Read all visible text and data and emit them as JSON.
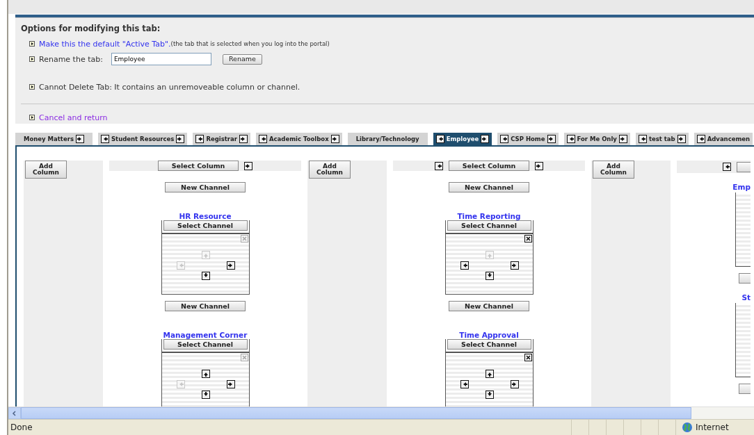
{
  "options": {
    "heading": "Options for modifying this tab:",
    "default_link": "Make this the default \"Active Tab\".",
    "default_note": "(the tab that is selected when you log into the portal)",
    "rename_label": "Rename the tab:",
    "rename_value": "Employee",
    "rename_button": "Rename",
    "delete_note": "Cannot Delete Tab: It contains an unremoveable column or channel.",
    "cancel_link": "Cancel and return"
  },
  "tabs": [
    {
      "label": "Money Matters",
      "selected": false,
      "move_left": false,
      "move_right": true
    },
    {
      "label": "Student Resources",
      "selected": false,
      "move_left": true,
      "move_right": true
    },
    {
      "label": "Registrar",
      "selected": false,
      "move_left": true,
      "move_right": true
    },
    {
      "label": "Academic Toolbox",
      "selected": false,
      "move_left": true,
      "move_right": true
    },
    {
      "label": "Library/Technology",
      "selected": false,
      "move_left": false,
      "move_right": false
    },
    {
      "label": "Employee",
      "selected": true,
      "move_left": true,
      "move_right": true
    },
    {
      "label": "CSP Home",
      "selected": false,
      "move_left": true,
      "move_right": true
    },
    {
      "label": "For Me Only",
      "selected": false,
      "move_left": true,
      "move_right": true
    },
    {
      "label": "test tab",
      "selected": false,
      "move_left": true,
      "move_right": true
    },
    {
      "label": "Advancemen",
      "selected": false,
      "move_left": true,
      "move_right": false
    }
  ],
  "columns": [
    {
      "kind": "add",
      "label": "Add Column"
    },
    {
      "kind": "channels",
      "select_label": "Select Column",
      "move_left": false,
      "move_right": true,
      "items": [
        {
          "kind": "new",
          "label": "New Channel"
        },
        {
          "kind": "channel",
          "title": "HR Resource",
          "select_label": "Select Channel",
          "removable": false,
          "up": false,
          "left": false,
          "right": true,
          "down": true
        },
        {
          "kind": "new",
          "label": "New Channel"
        },
        {
          "kind": "channel",
          "title": "Management Corner",
          "select_label": "Select Channel",
          "removable": false,
          "up": true,
          "left": false,
          "right": true,
          "down": true
        }
      ]
    },
    {
      "kind": "add",
      "label": "Add Column"
    },
    {
      "kind": "channels",
      "select_label": "Select Column",
      "move_left": true,
      "move_right": true,
      "items": [
        {
          "kind": "new",
          "label": "New Channel"
        },
        {
          "kind": "channel",
          "title": "Time Reporting",
          "select_label": "Select Channel",
          "removable": true,
          "up": false,
          "left": true,
          "right": true,
          "down": true
        },
        {
          "kind": "new",
          "label": "New Channel"
        },
        {
          "kind": "channel",
          "title": "Time Approval",
          "select_label": "Select Channel",
          "removable": true,
          "up": true,
          "left": true,
          "right": true,
          "down": true
        }
      ]
    },
    {
      "kind": "add",
      "label": "Add Column"
    },
    {
      "kind": "cut",
      "move_left": true,
      "items": [
        {
          "kind": "channel",
          "title": "Emp"
        },
        {
          "kind": "new"
        },
        {
          "kind": "channel",
          "title": "St"
        },
        {
          "kind": "new"
        }
      ]
    }
  ],
  "status_bar": {
    "text": "Done",
    "zone": "Internet"
  }
}
